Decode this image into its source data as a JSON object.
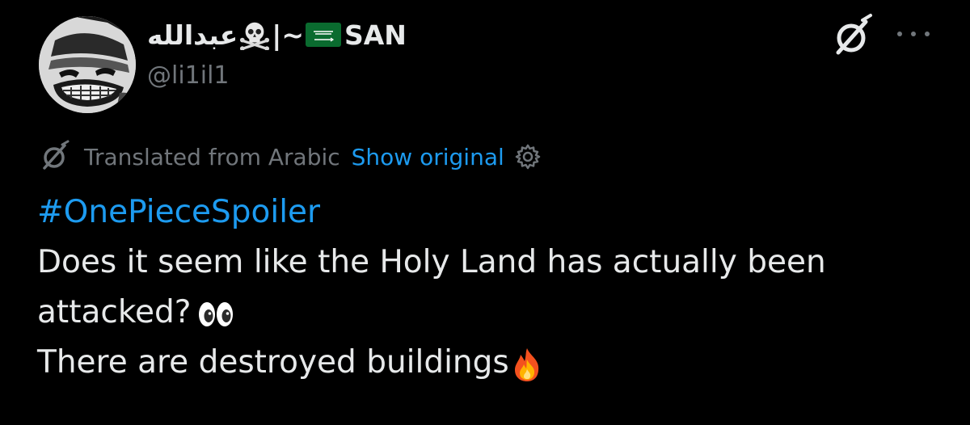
{
  "author": {
    "display_name_arabic": "عبدالله",
    "display_name_separator": "|~",
    "display_name_latin": "SAN",
    "handle": "@li1il1",
    "emoji": [
      "skull-and-crossbones",
      "saudi-arabia-flag"
    ]
  },
  "translation": {
    "label": "Translated from Arabic",
    "show_original": "Show original"
  },
  "content": {
    "hashtag": "#OnePieceSpoiler",
    "line1": "Does it seem like the Holy Land has actually been",
    "line2": "attacked?",
    "line3": "There are destroyed buildings",
    "emoji": [
      "eyes",
      "fire"
    ]
  },
  "icons": [
    "grok-icon",
    "more-options-icon",
    "settings-gear-icon"
  ],
  "colors": {
    "background": "#000000",
    "text": "#e7e9ea",
    "muted": "#71767b",
    "accent": "#1d9bf0"
  }
}
